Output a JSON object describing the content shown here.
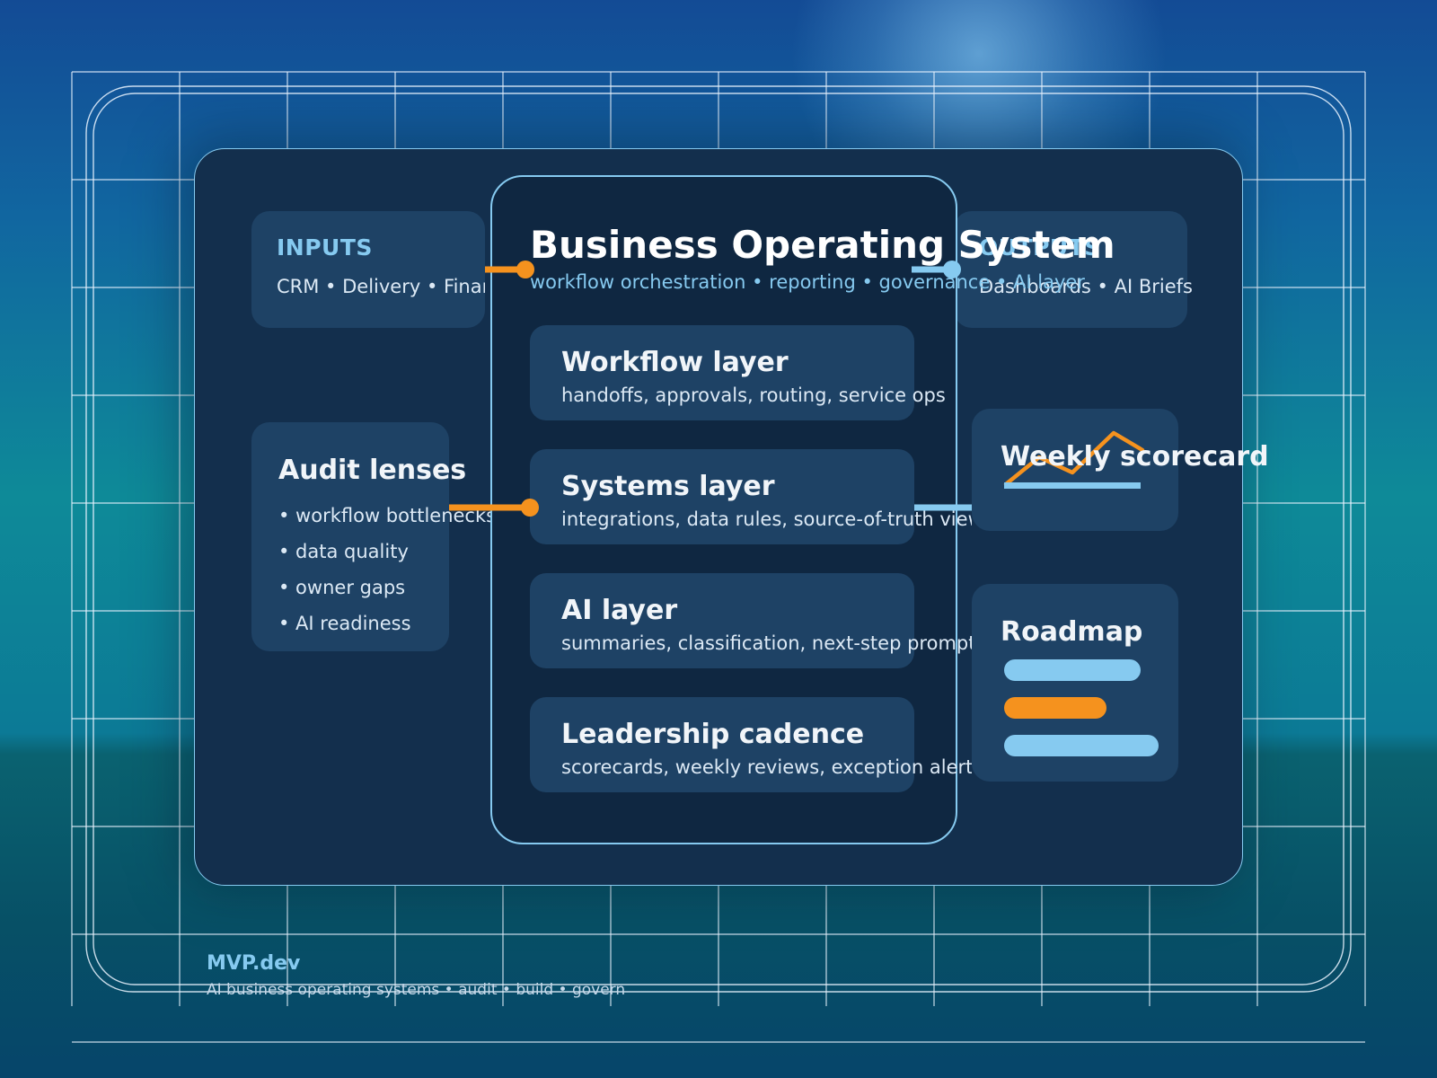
{
  "colors": {
    "accent_orange": "#f5921e",
    "accent_blue": "#86caf0",
    "panel": "#132f4d",
    "card": "#1e4265",
    "central": "#0f2741"
  },
  "inputs": {
    "title": "INPUTS",
    "text": "CRM • Delivery • Finance"
  },
  "outputs": {
    "title": "OUTPUTS",
    "text": "Dashboards • AI Briefs"
  },
  "audit": {
    "title": "Audit lenses",
    "items": [
      "• workflow bottlenecks",
      "• data quality",
      "• owner gaps",
      "• AI readiness"
    ]
  },
  "central": {
    "title": "Business Operating System",
    "subtitle": "workflow orchestration • reporting • governance • AI layer",
    "layers": [
      {
        "title": "Workflow layer",
        "desc": "handoffs, approvals, routing, service ops"
      },
      {
        "title": "Systems layer",
        "desc": "integrations, data rules, source-of-truth views"
      },
      {
        "title": "AI layer",
        "desc": "summaries, classification, next-step prompts"
      },
      {
        "title": "Leadership cadence",
        "desc": "scorecards, weekly reviews, exception alerts"
      }
    ]
  },
  "scorecard": {
    "title": "Weekly scorecard",
    "icon": "trend-line-icon"
  },
  "roadmap": {
    "title": "Roadmap",
    "icon": "roadmap-bars-icon"
  },
  "footer": {
    "brand": "MVP.dev",
    "tagline": "AI business operating systems • audit • build • govern"
  }
}
